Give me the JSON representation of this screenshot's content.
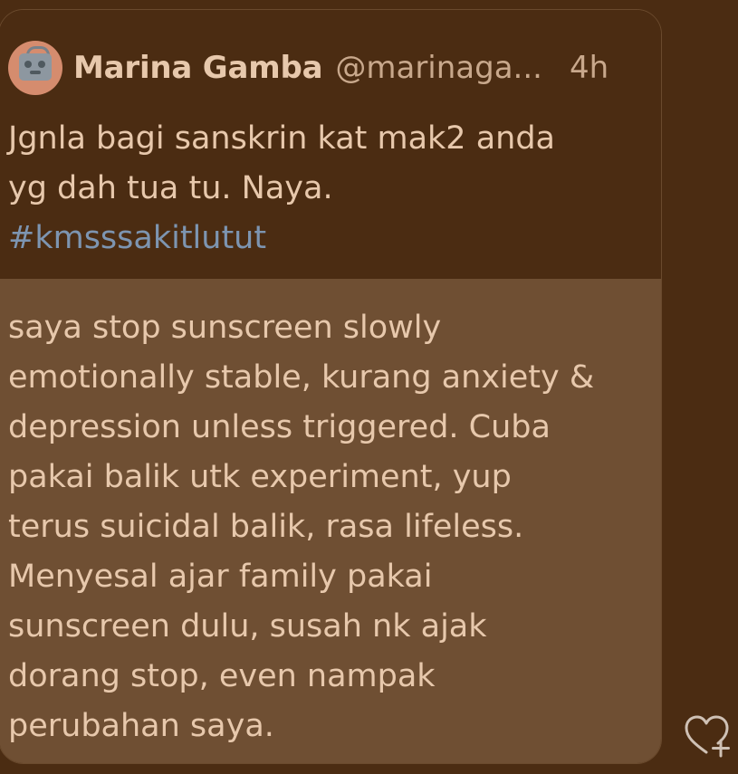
{
  "colors": {
    "background": "#4b2c12",
    "quoted_tweet_background": "#4b2c12",
    "reply_background": "#6f4f33",
    "primary_text": "#e7c8ac",
    "secondary_text": "#c8a88c",
    "hashtag": "#7d95b1"
  },
  "quoted_tweet": {
    "author": {
      "display_name": "Marina Gamba",
      "handle": "@marinaga...",
      "avatar_icon": "handbag-avatar-icon"
    },
    "timestamp": "4h",
    "text_lines": [
      "Jgnla bagi sanskrin kat mak2 anda",
      "yg dah tua tu. Naya."
    ],
    "hashtag": "#kmsssakitlutut"
  },
  "reply": {
    "lines": [
      "saya stop sunscreen slowly",
      "emotionally stable, kurang anxiety &",
      "depression unless triggered. Cuba",
      "pakai balik utk experiment, yup",
      "terus suicidal balik, rasa lifeless.",
      "Menyesal ajar family pakai",
      "sunscreen dulu, susah nk ajak",
      "dorang stop, even nampak",
      "perubahan saya."
    ]
  },
  "actions": {
    "like_icon": "heart-plus-icon"
  }
}
